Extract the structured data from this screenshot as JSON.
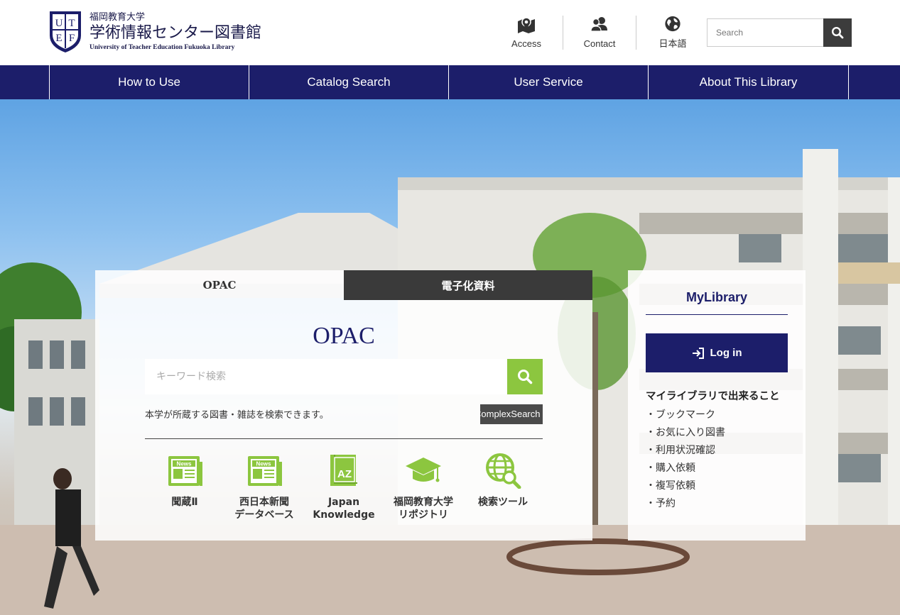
{
  "header": {
    "logo": {
      "emblem_letters": [
        "U",
        "T",
        "E",
        "F"
      ],
      "subtitle": "福岡教育大学",
      "title": "学術情報センター図書館",
      "english": "University of Teacher Education Fukuoka Library"
    },
    "links": [
      {
        "label": "Access",
        "icon": "map-pin-icon"
      },
      {
        "label": "Contact",
        "icon": "people-icon"
      },
      {
        "label": "日本語",
        "icon": "globe-icon"
      }
    ],
    "search": {
      "placeholder": "Search",
      "icon": "search-icon"
    }
  },
  "nav": {
    "items": [
      "How to Use",
      "Catalog Search",
      "User Service",
      "About This Library"
    ]
  },
  "opac": {
    "tabs": [
      "OPAC",
      "電子化資料"
    ],
    "title": "OPAC",
    "search_placeholder": "キーワード検索",
    "note": "本学が所蔵する図書・雑誌を検索できます。",
    "complex_label": "ComplexSearch",
    "databases": [
      {
        "label": "聞蔵Ⅱ",
        "icon": "news-icon"
      },
      {
        "label": "西日本新聞\nデータベース",
        "icon": "news-icon"
      },
      {
        "label": "Japan\nKnowledge",
        "icon": "book-az-icon"
      },
      {
        "label": "福岡教育大学\nリポジトリ",
        "icon": "graduation-cap-icon"
      },
      {
        "label": "検索ツール",
        "icon": "globe-search-icon"
      }
    ]
  },
  "mylibrary": {
    "title": "MyLibrary",
    "login_label": "Log in",
    "features_title": "マイライブラリで出来ること",
    "features": [
      "・ブックマーク",
      "・お気に入り図書",
      "・利用状況確認",
      "・購入依頼",
      "・複写依頼",
      "・予約"
    ]
  },
  "colors": {
    "navy": "#1c1e6a",
    "green": "#8cc63f",
    "dark": "#3a3a3a"
  }
}
